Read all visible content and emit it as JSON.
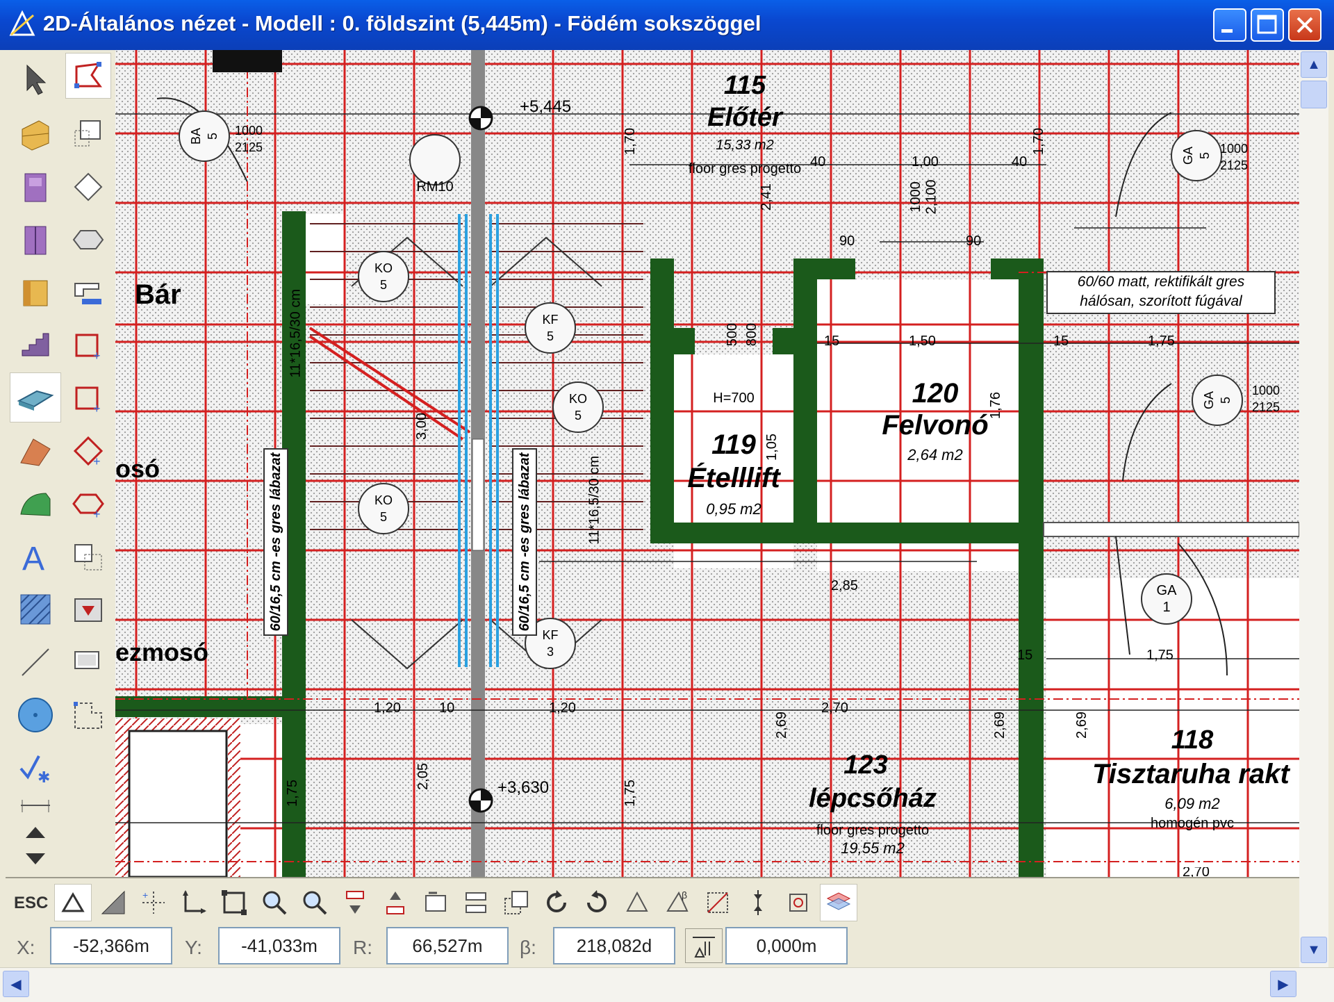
{
  "window": {
    "title": "2D-Általános nézet - Modell : 0. földszint (5,445m) - Födém sokszöggel"
  },
  "toolbox": {
    "tools": [
      "arrow-icon",
      "polygon-select-icon",
      "wall-icon",
      "rotate-icon",
      "door-icon",
      "rotate-diamond-icon",
      "window-icon",
      "hexagon-icon",
      "object-icon",
      "corner-icon",
      "stair-icon",
      "add-node-icon",
      "slab-icon",
      "add-node2-icon",
      "roof-icon",
      "edit-node-icon",
      "shell-icon",
      "hex-add-icon",
      "text-icon",
      "mirror-icon",
      "hatch-icon",
      "transform-icon",
      "line-icon",
      "stretch-icon",
      "circle-icon",
      "corner-edit-icon",
      "check-icon",
      "dimension-icon",
      "arrow-up-icon",
      "arrow-down-icon"
    ]
  },
  "plan": {
    "rooms": [
      {
        "number": "115",
        "name": "Előtér",
        "area": "15,33 m2",
        "finish": "floor gres progetto"
      },
      {
        "number": "120",
        "name": "Felvonó",
        "area": "2,64 m2"
      },
      {
        "number": "119",
        "name": "Ételllift",
        "area": "0,95 m2",
        "extra": "H=700"
      },
      {
        "number": "123",
        "name": "lépcsőház",
        "area": "19,55 m2",
        "finish": "floor gres progetto"
      },
      {
        "number": "118",
        "name": "Tisztaruha rakt",
        "area": "6,09 m2",
        "finish": "homogén pvc"
      }
    ],
    "labels": {
      "bar": "Bár",
      "oso": "osó",
      "ezmoso": "ezmosó",
      "level1": "+5,445",
      "level2": "+3,630",
      "note1": "60/60 matt, rektifikált gres",
      "note2": "hálósan, szorított fúgával",
      "stair_text": "60/16,5 cm -es gres lábazat",
      "stair_count": "11*16,5/30 cm",
      "rm10": "RM10"
    },
    "dims": {
      "d120": "1,20",
      "d10": "10",
      "d120b": "1,20",
      "d270": "2,70",
      "d40": "40",
      "d100": "1,00",
      "d90": "90",
      "d150": "1,50",
      "d175": "1,75",
      "d176": "1,76",
      "d105": "1,05",
      "d269": "2,69",
      "d205": "2,05",
      "d175b": "1,75",
      "d285": "2,85",
      "d300": "3,00",
      "d241": "2,41",
      "d15": "15",
      "d500": "500",
      "d800": "800",
      "d1000": "1000",
      "d2125": "2125",
      "d2100": "2,100",
      "d170": "1,70",
      "d270b": "2,70"
    },
    "tags": [
      {
        "code": "KO",
        "n": "5"
      },
      {
        "code": "KF",
        "n": "5"
      },
      {
        "code": "KO",
        "n": "5"
      },
      {
        "code": "KO",
        "n": "5"
      },
      {
        "code": "KF",
        "n": "3"
      },
      {
        "code": "GA",
        "n": "1"
      },
      {
        "code": "BA",
        "n": "5"
      },
      {
        "code": "GA",
        "n": "5"
      },
      {
        "code": "GA",
        "n": "5"
      }
    ]
  },
  "coords": {
    "esc": "ESC",
    "x_label": "X:",
    "x": "-52,366m",
    "y_label": "Y:",
    "y": "-41,033m",
    "r_label": "R:",
    "r": "66,527m",
    "b_label": "β:",
    "b": "218,082d",
    "z": "0,000m"
  },
  "colors": {
    "accent": "#0a48d0",
    "grid": "#d42020",
    "wall": "#1b5a1b",
    "stair_blue": "#2aa0e0"
  }
}
